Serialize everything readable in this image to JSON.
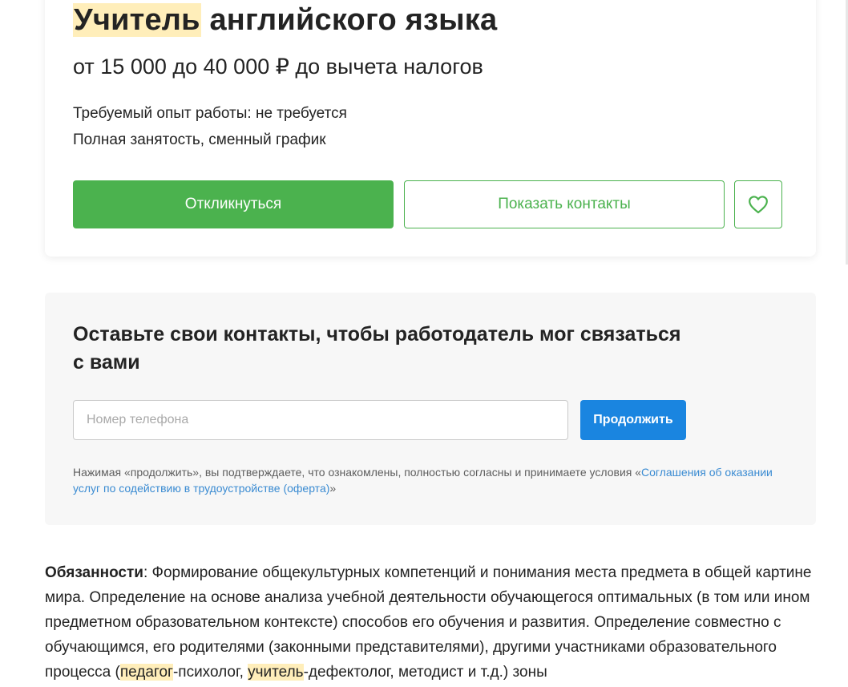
{
  "vacancy": {
    "title_highlight": "Учитель",
    "title_rest": " английского языка",
    "salary": "от 15 000 до 40 000 ₽ до вычета налогов",
    "experience": "Требуемый опыт работы: не требуется",
    "employment": "Полная занятость, сменный график",
    "respond_label": "Откликнуться",
    "show_contacts_label": "Показать контакты",
    "favorite_icon": "heart-icon",
    "accent_color": "#4bb24e"
  },
  "contact_form": {
    "title": "Оставьте свои контакты, чтобы работодатель мог связаться с вами",
    "phone_placeholder": "Номер телефона",
    "phone_value": "",
    "continue_label": "Продолжить",
    "continue_color": "#1a85e0",
    "agreement_prefix": "Нажимая «продолжить», вы подтверждаете, что ознакомлены, полностью согласны и принимаете условия «",
    "agreement_link": "Соглашения об оказании услуг по содействию в трудоустройстве (оферта)",
    "agreement_suffix": "»"
  },
  "description": {
    "label": "Обязанности",
    "text_1": ": Формирование общекультурных компетенций и понимания места предмета в общей картине мира. Определение на основе анализа учебной деятельности обучающегося оптимальных (в том или ином предметном образовательном контексте) способов его обучения и развития. Определение совместно с обучающимся, его родителями (законными представителями), другими участниками образовательного процесса (",
    "highlight_1": "педагог",
    "text_2": "-психолог, ",
    "highlight_2": "учитель",
    "text_3": "-дефектолог, методист и т.д.) зоны",
    "highlight_color": "#ffeeba"
  }
}
